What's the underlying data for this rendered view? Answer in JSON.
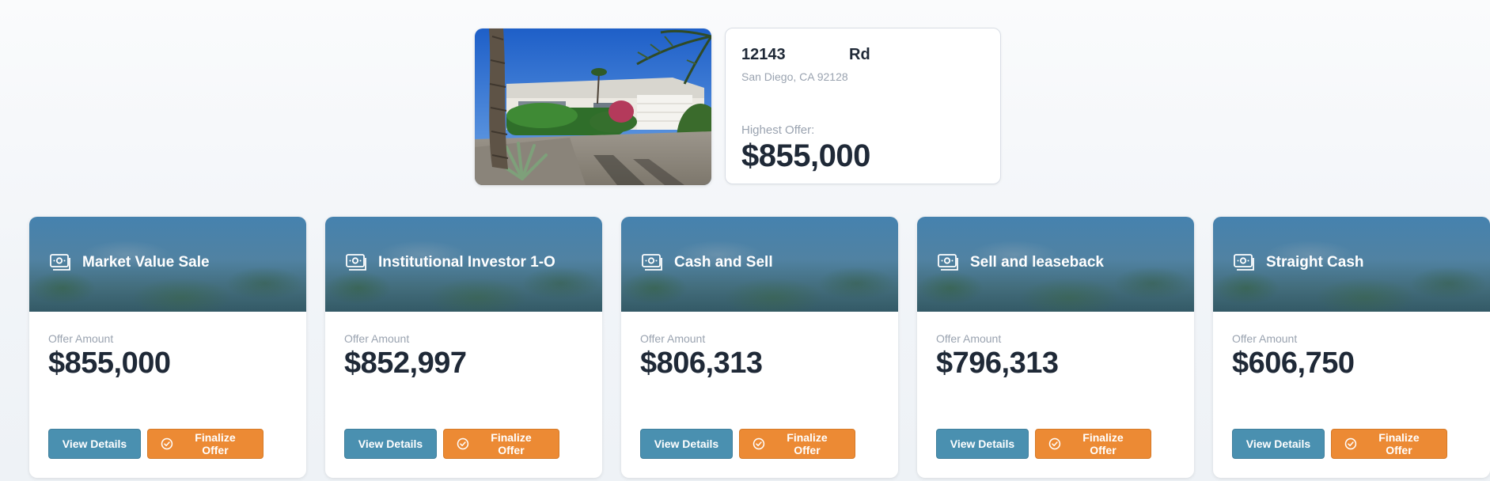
{
  "property": {
    "address_number": "12143",
    "address_street": "Rd",
    "city_line": "San Diego, CA 92128",
    "highest_offer_label": "Highest Offer:",
    "highest_offer_value": "$855,000"
  },
  "offers": [
    {
      "title": "Market Value Sale",
      "amount_label": "Offer Amount",
      "amount": "$855,000",
      "view_label": "View Details",
      "finalize_label": "Finalize Offer"
    },
    {
      "title": "Institutional Investor 1-O",
      "amount_label": "Offer Amount",
      "amount": "$852,997",
      "view_label": "View Details",
      "finalize_label": "Finalize Offer"
    },
    {
      "title": "Cash and Sell",
      "amount_label": "Offer Amount",
      "amount": "$806,313",
      "view_label": "View Details",
      "finalize_label": "Finalize Offer"
    },
    {
      "title": "Sell and leaseback",
      "amount_label": "Offer Amount",
      "amount": "$796,313",
      "view_label": "View Details",
      "finalize_label": "Finalize Offer"
    },
    {
      "title": "Straight Cash",
      "amount_label": "Offer Amount",
      "amount": "$606,750",
      "view_label": "View Details",
      "finalize_label": "Finalize Offer"
    }
  ],
  "colors": {
    "view_button": "#4a90b0",
    "finalize_button": "#ec8a34",
    "text_dark": "#1f2937",
    "text_muted": "#9aa3b0"
  },
  "icons": {
    "offer_header": "money-icon",
    "finalize": "check-circle-icon"
  }
}
